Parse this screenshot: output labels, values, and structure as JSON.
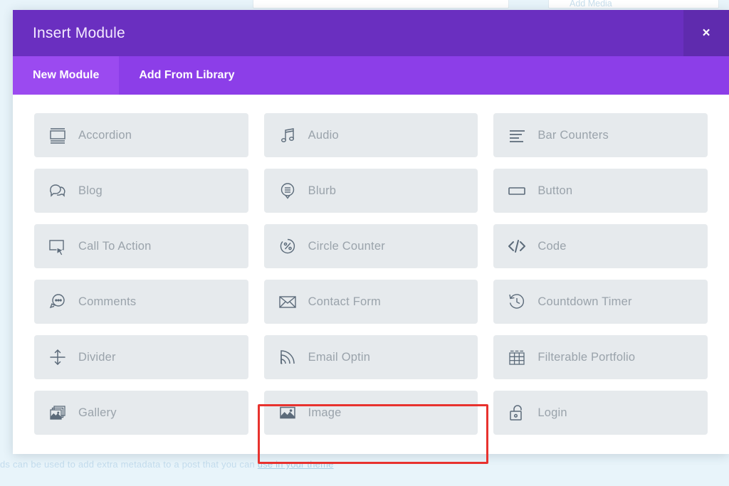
{
  "modal": {
    "title": "Insert Module",
    "close_icon": "close-icon",
    "close_label": "×",
    "tabs": [
      {
        "label": "New Module",
        "active": true
      },
      {
        "label": "Add From Library",
        "active": false
      }
    ],
    "modules": [
      {
        "label": "Accordion",
        "icon": "accordion-icon"
      },
      {
        "label": "Audio",
        "icon": "audio-icon"
      },
      {
        "label": "Bar Counters",
        "icon": "bar-counters-icon"
      },
      {
        "label": "Blog",
        "icon": "blog-icon"
      },
      {
        "label": "Blurb",
        "icon": "blurb-icon"
      },
      {
        "label": "Button",
        "icon": "button-icon"
      },
      {
        "label": "Call To Action",
        "icon": "call-to-action-icon"
      },
      {
        "label": "Circle Counter",
        "icon": "circle-counter-icon"
      },
      {
        "label": "Code",
        "icon": "code-icon"
      },
      {
        "label": "Comments",
        "icon": "comments-icon"
      },
      {
        "label": "Contact Form",
        "icon": "contact-form-icon"
      },
      {
        "label": "Countdown Timer",
        "icon": "countdown-timer-icon"
      },
      {
        "label": "Divider",
        "icon": "divider-icon"
      },
      {
        "label": "Email Optin",
        "icon": "email-optin-icon"
      },
      {
        "label": "Filterable Portfolio",
        "icon": "filterable-portfolio-icon"
      },
      {
        "label": "Gallery",
        "icon": "gallery-icon"
      },
      {
        "label": "Image",
        "icon": "image-icon"
      },
      {
        "label": "Login",
        "icon": "login-icon"
      }
    ]
  },
  "backdrop": {
    "ghost_text_prefix": "ds can be used to add extra metadata to a post that you can ",
    "ghost_link_text": "use in your theme",
    "ghost_chip_right": "Add Media"
  },
  "colors": {
    "header_purple": "#6a2fc0",
    "close_purple": "#5f2bae",
    "tab_bar_purple": "#8c3ee8",
    "tab_active_purple": "#9b4af0",
    "tile_gray": "#e6eaed",
    "label_gray": "#9aa3ab",
    "icon_gray": "#5c6b7a",
    "highlight_red": "#e8322e",
    "backdrop_blue": "#e8f4fa"
  }
}
